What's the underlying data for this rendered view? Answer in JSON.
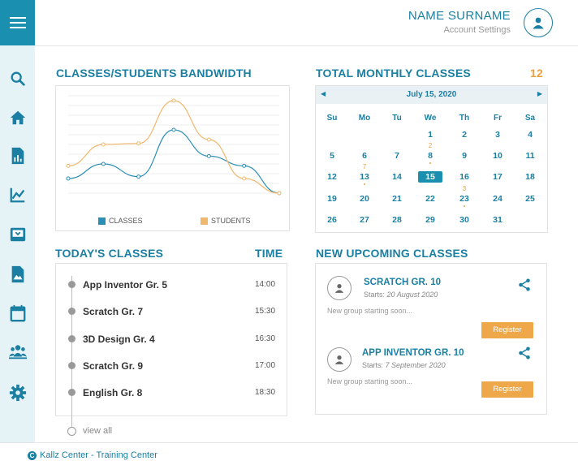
{
  "header": {
    "user_name": "NAME SURNAME",
    "account_settings": "Account Settings"
  },
  "sidebar": {
    "items": [
      {
        "icon": "search-icon"
      },
      {
        "icon": "home-icon"
      },
      {
        "icon": "report-icon"
      },
      {
        "icon": "analytics-icon"
      },
      {
        "icon": "inbox-icon"
      },
      {
        "icon": "image-file-icon"
      },
      {
        "icon": "calendar-icon"
      },
      {
        "icon": "group-icon"
      },
      {
        "icon": "settings-icon"
      }
    ]
  },
  "bandwidth": {
    "title": "CLASSES/STUDENTS  BANDWIDTH",
    "legend_classes": "CLASSES",
    "legend_students": "STUDENTS",
    "color_classes": "#2b8fb5",
    "color_students": "#f0b86e"
  },
  "chart_data": {
    "type": "line",
    "title": "CLASSES/STUDENTS  BANDWIDTH",
    "x": [
      1,
      2,
      3,
      4,
      5,
      6,
      7
    ],
    "ylim": [
      0,
      100
    ],
    "grid": true,
    "legend_position": "bottom",
    "series": [
      {
        "name": "CLASSES",
        "values": [
          15,
          30,
          17,
          65,
          38,
          28,
          0
        ],
        "color": "#2b8fb5"
      },
      {
        "name": "STUDENTS",
        "values": [
          28,
          50,
          51,
          95,
          55,
          15,
          0
        ],
        "color": "#f0b86e"
      }
    ]
  },
  "monthly": {
    "title": "TOTAL MONTHLY CLASSES",
    "count": "12",
    "month_label": "July 15, 2020",
    "days_of_week": [
      "Su",
      "Mo",
      "Tu",
      "We",
      "Th",
      "Fr",
      "Sa"
    ],
    "weeks": [
      [
        "",
        "",
        "",
        "1",
        "2",
        "3",
        "4"
      ],
      [
        "5",
        "6",
        "7",
        "8",
        "9",
        "10",
        "11"
      ],
      [
        "12",
        "13",
        "14",
        "15",
        "16",
        "17",
        "18"
      ],
      [
        "19",
        "20",
        "21",
        "22",
        "23",
        "24",
        "25"
      ],
      [
        "26",
        "27",
        "28",
        "29",
        "30",
        "31",
        ""
      ]
    ],
    "today": "15",
    "events": [
      {
        "day": "8",
        "count": "2"
      },
      {
        "day": "13",
        "count": "7"
      },
      {
        "day": "23",
        "count": "3"
      }
    ]
  },
  "today": {
    "title": "TODAY'S CLASSES",
    "time_label": "TIME",
    "classes": [
      {
        "name": "App Inventor Gr. 5",
        "time": "14:00"
      },
      {
        "name": "Scratch Gr. 7",
        "time": "15:30"
      },
      {
        "name": "3D Design Gr. 4",
        "time": "16:30"
      },
      {
        "name": "Scratch Gr. 9",
        "time": "17:00"
      },
      {
        "name": "English Gr. 8",
        "time": "18:30"
      }
    ],
    "view_all": "view all"
  },
  "upcoming": {
    "title": "NEW UPCOMING CLASSES",
    "items": [
      {
        "title": "SCRATCH  GR. 10",
        "starts_label": "Starts:",
        "starts_date": "20 August 2020",
        "desc": "New group starting soon...",
        "button": "Register"
      },
      {
        "title": "APP INVENTOR GR. 10",
        "starts_label": "Starts:",
        "starts_date": "7 September 2020",
        "desc": "New group starting soon...",
        "button": "Register"
      }
    ]
  },
  "footer": {
    "text": "Kallz Center - Training Center"
  }
}
